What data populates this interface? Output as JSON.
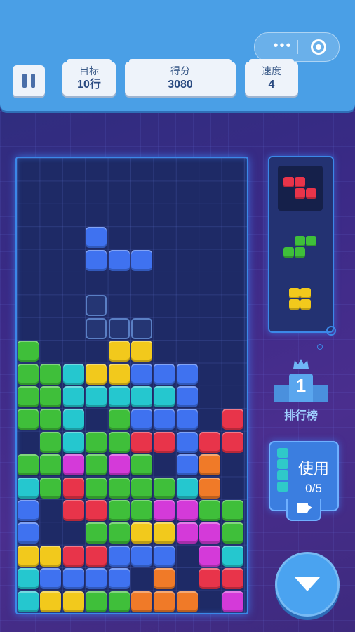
{
  "header": {
    "target_label": "目标",
    "target_value": "10行",
    "score_label": "得分",
    "score_value": "3080",
    "speed_label": "速度",
    "speed_value": "4"
  },
  "capsule": {
    "menu_glyph": "•••"
  },
  "sidebar": {
    "rank_number": "1",
    "rank_label": "排行榜",
    "use_label": "使用",
    "use_count": "0/5"
  },
  "colors": {
    "blue": "#3f72f0",
    "green": "#3fbf3a",
    "cyan": "#25c7cf",
    "yellow": "#f2c91c",
    "red": "#e8344a",
    "orange": "#f07a28",
    "magenta": "#d43ad9",
    "board_border": "#3b88e8",
    "header_bg": "#4a9fe6"
  },
  "board": {
    "columns": 10,
    "rows": 20,
    "active_piece": {
      "color": "blue",
      "cells": [
        [
          3,
          3
        ],
        [
          3,
          4
        ],
        [
          4,
          4
        ],
        [
          5,
          4
        ]
      ]
    },
    "ghost_piece": {
      "cells": [
        [
          3,
          6
        ],
        [
          3,
          7
        ],
        [
          4,
          7
        ],
        [
          5,
          7
        ]
      ]
    },
    "stack": [
      "..........",
      "..........",
      "..........",
      "..........",
      "..........",
      "..........",
      "..........",
      "..........",
      "G...YY....",
      "GGCYYBBB..",
      "GGCCCCCB..",
      "GGC.GBBB.R",
      ".GCGGRRBRR",
      "GGMGMG.BO.",
      "CGRGGGGCO.",
      "B.RRGGMMGG",
      "B..GGYYMMG",
      "YYRRBBB.MC",
      "CBBBB.O.RR",
      "CYYGGOOO.M"
    ]
  },
  "next_pieces": [
    {
      "color": "red",
      "shape": "Z"
    },
    {
      "color": "green",
      "shape": "S"
    },
    {
      "color": "yellow",
      "shape": "O"
    }
  ],
  "icons": {
    "pause": "pause-icon",
    "menu": "more-dots-icon",
    "close": "target-circle-icon",
    "crown": "crown-icon",
    "video": "video-icon",
    "drop": "arrow-down-icon"
  }
}
